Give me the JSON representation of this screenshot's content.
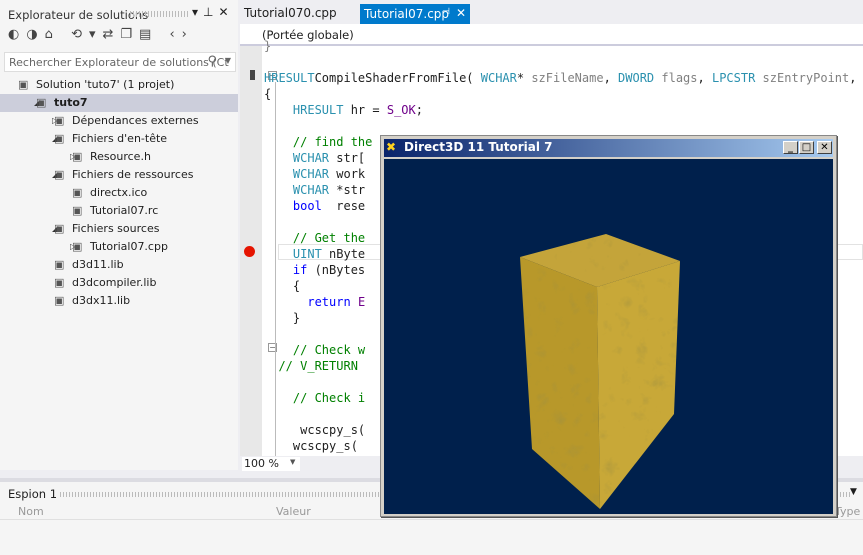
{
  "solution_explorer": {
    "title": "Explorateur de solutions",
    "search_placeholder": "Rechercher Explorateur de solutions (Ct",
    "items": [
      {
        "label": "Solution 'tuto7' (1 projet)",
        "icon": "solution-icon",
        "indent": 0,
        "arrow": ""
      },
      {
        "label": "tuto7",
        "icon": "project-icon",
        "indent": 1,
        "arrow": "◢",
        "selected": true
      },
      {
        "label": "Dépendances externes",
        "icon": "dependencies-icon",
        "indent": 2,
        "arrow": "▷"
      },
      {
        "label": "Fichiers d'en-tête",
        "icon": "folder-icon",
        "indent": 2,
        "arrow": "◢"
      },
      {
        "label": "Resource.h",
        "icon": "header-file-icon",
        "indent": 3,
        "arrow": "▷"
      },
      {
        "label": "Fichiers de ressources",
        "icon": "folder-icon",
        "indent": 2,
        "arrow": "◢"
      },
      {
        "label": "directx.ico",
        "icon": "image-file-icon",
        "indent": 3,
        "arrow": ""
      },
      {
        "label": "Tutorial07.rc",
        "icon": "resource-file-icon",
        "indent": 3,
        "arrow": ""
      },
      {
        "label": "Fichiers sources",
        "icon": "folder-icon",
        "indent": 2,
        "arrow": "◢"
      },
      {
        "label": "Tutorial07.cpp",
        "icon": "cpp-file-icon",
        "indent": 3,
        "arrow": "▷"
      },
      {
        "label": "d3d11.lib",
        "icon": "lib-file-icon",
        "indent": 2,
        "arrow": ""
      },
      {
        "label": "d3dcompiler.lib",
        "icon": "lib-file-icon",
        "indent": 2,
        "arrow": ""
      },
      {
        "label": "d3dx11.lib",
        "icon": "lib-file-icon",
        "indent": 2,
        "arrow": ""
      }
    ]
  },
  "editor": {
    "tabs": [
      "Tutorial070.cpp",
      "Tutorial07.cpp"
    ],
    "scope": "(Portée globale)",
    "zoom": "100 %",
    "lines": [
      [
        [
          "p",
          "}"
        ]
      ],
      [],
      [
        [
          "k",
          "HRESULT"
        ],
        [
          "",
          "CompileShaderFromFile( "
        ],
        [
          "k",
          "WCHAR"
        ],
        [
          "",
          "* "
        ],
        [
          "p",
          "szFileName"
        ],
        [
          "",
          ", "
        ],
        [
          "k",
          "DWORD"
        ],
        [
          "p",
          " flags"
        ],
        [
          "",
          ", "
        ],
        [
          "k",
          "LPCSTR"
        ],
        [
          "p",
          " szEntryPoint"
        ],
        [
          "",
          ","
        ]
      ],
      [
        [
          "",
          "{"
        ]
      ],
      [
        [
          "",
          "    "
        ],
        [
          "k",
          "HRESULT"
        ],
        [
          "",
          " hr = "
        ],
        [
          "m",
          "S_OK"
        ],
        [
          "",
          ";"
        ]
      ],
      [],
      [
        [
          "g",
          "    // find the"
        ]
      ],
      [
        [
          "",
          "    "
        ],
        [
          "k",
          "WCHAR"
        ],
        [
          "",
          " str["
        ]
      ],
      [
        [
          "",
          "    "
        ],
        [
          "k",
          "WCHAR"
        ],
        [
          "",
          " work"
        ]
      ],
      [
        [
          "",
          "    "
        ],
        [
          "k",
          "WCHAR"
        ],
        [
          "",
          " *str"
        ]
      ],
      [
        [
          "",
          "    "
        ],
        [
          "b",
          "bool"
        ],
        [
          "",
          "  rese"
        ]
      ],
      [],
      [
        [
          "g",
          "    // Get the"
        ]
      ],
      [
        [
          "",
          "    "
        ],
        [
          "k",
          "UINT"
        ],
        [
          "",
          " nByte"
        ]
      ],
      [
        [
          "",
          "    "
        ],
        [
          "b",
          "if"
        ],
        [
          "",
          " (nBytes"
        ]
      ],
      [
        [
          "",
          "    {"
        ]
      ],
      [
        [
          "",
          "      "
        ],
        [
          "b",
          "return"
        ],
        [
          "m",
          " E"
        ]
      ],
      [
        [
          "",
          "    }"
        ]
      ],
      [],
      [
        [
          "g",
          "    // Check w"
        ]
      ],
      [
        [
          "g",
          "  // V_RETURN"
        ]
      ],
      [],
      [
        [
          "g",
          "    // Check i"
        ]
      ],
      [],
      [
        [
          "",
          "     wcscpy_s("
        ]
      ],
      [
        [
          "",
          "    wcscpy_s( "
        ]
      ]
    ]
  },
  "watch": {
    "title": "Espion 1",
    "columns": [
      "Nom",
      "Valeur",
      "Type"
    ]
  },
  "d3d_window": {
    "title": "Direct3D 11 Tutorial 7",
    "background": "#00204c",
    "cube_color": "#b8982a"
  }
}
